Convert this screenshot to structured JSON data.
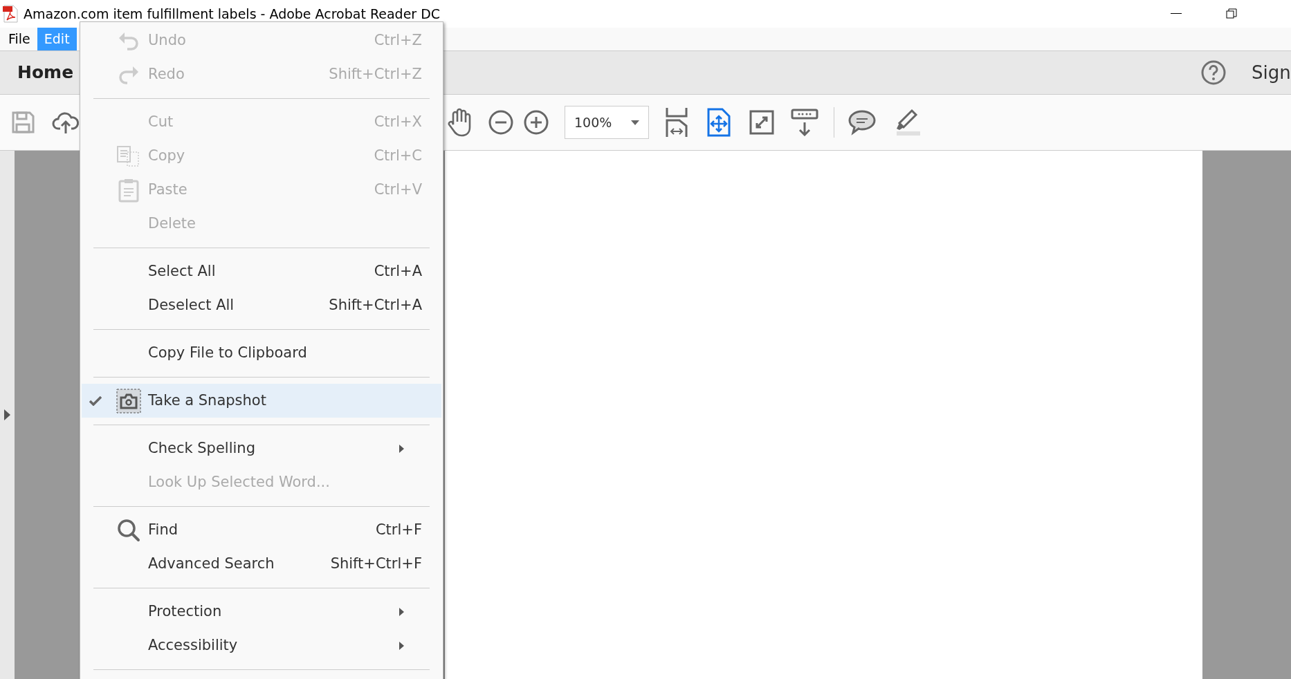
{
  "window": {
    "title": "Amazon.com item fulfillment labels - Adobe Acrobat Reader DC"
  },
  "menu_bar": [
    {
      "label": "File",
      "selected": false
    },
    {
      "label": "Edit",
      "selected": true
    }
  ],
  "nav_bar": {
    "home": "Home",
    "sign": "Sign"
  },
  "toolbar": {
    "zoom": "100%"
  },
  "edit_menu": [
    {
      "kind": "undo",
      "label": "Undo",
      "shortcut": "Ctrl+Z",
      "disabled": true,
      "checked": false,
      "selected": false,
      "submenu": false
    },
    {
      "kind": "redo",
      "label": "Redo",
      "shortcut": "Shift+Ctrl+Z",
      "disabled": true,
      "checked": false,
      "selected": false,
      "submenu": false
    },
    {
      "kind": "separator"
    },
    {
      "kind": "item",
      "label": "Cut",
      "shortcut": "Ctrl+X",
      "disabled": true,
      "checked": false,
      "selected": false,
      "submenu": false
    },
    {
      "kind": "copy",
      "label": "Copy",
      "shortcut": "Ctrl+C",
      "disabled": true,
      "checked": false,
      "selected": false,
      "submenu": false
    },
    {
      "kind": "paste",
      "label": "Paste",
      "shortcut": "Ctrl+V",
      "disabled": true,
      "checked": false,
      "selected": false,
      "submenu": false
    },
    {
      "kind": "item",
      "label": "Delete",
      "disabled": true,
      "checked": false,
      "selected": false,
      "submenu": false
    },
    {
      "kind": "separator"
    },
    {
      "kind": "item",
      "label": "Select All",
      "shortcut": "Ctrl+A",
      "disabled": false,
      "checked": false,
      "selected": false,
      "submenu": false
    },
    {
      "kind": "item",
      "label": "Deselect All",
      "shortcut": "Shift+Ctrl+A",
      "disabled": false,
      "checked": false,
      "selected": false,
      "submenu": false
    },
    {
      "kind": "separator"
    },
    {
      "kind": "item",
      "label": "Copy File to Clipboard",
      "disabled": false,
      "checked": false,
      "selected": false,
      "submenu": false
    },
    {
      "kind": "separator"
    },
    {
      "kind": "snapshot",
      "label": "Take a Snapshot",
      "disabled": false,
      "checked": true,
      "selected": true,
      "submenu": false
    },
    {
      "kind": "separator"
    },
    {
      "kind": "item",
      "label": "Check Spelling",
      "disabled": false,
      "checked": false,
      "selected": false,
      "submenu": true
    },
    {
      "kind": "item",
      "label": "Look Up Selected Word...",
      "disabled": true,
      "checked": false,
      "selected": false,
      "submenu": false
    },
    {
      "kind": "separator"
    },
    {
      "kind": "find",
      "label": "Find",
      "shortcut": "Ctrl+F",
      "disabled": false,
      "checked": false,
      "selected": false,
      "submenu": false
    },
    {
      "kind": "item",
      "label": "Advanced Search",
      "shortcut": "Shift+Ctrl+F",
      "disabled": false,
      "checked": false,
      "selected": false,
      "submenu": false
    },
    {
      "kind": "separator"
    },
    {
      "kind": "item",
      "label": "Protection",
      "disabled": false,
      "checked": false,
      "selected": false,
      "submenu": true
    },
    {
      "kind": "item",
      "label": "Accessibility",
      "disabled": false,
      "checked": false,
      "selected": false,
      "submenu": true
    },
    {
      "kind": "separator"
    }
  ]
}
